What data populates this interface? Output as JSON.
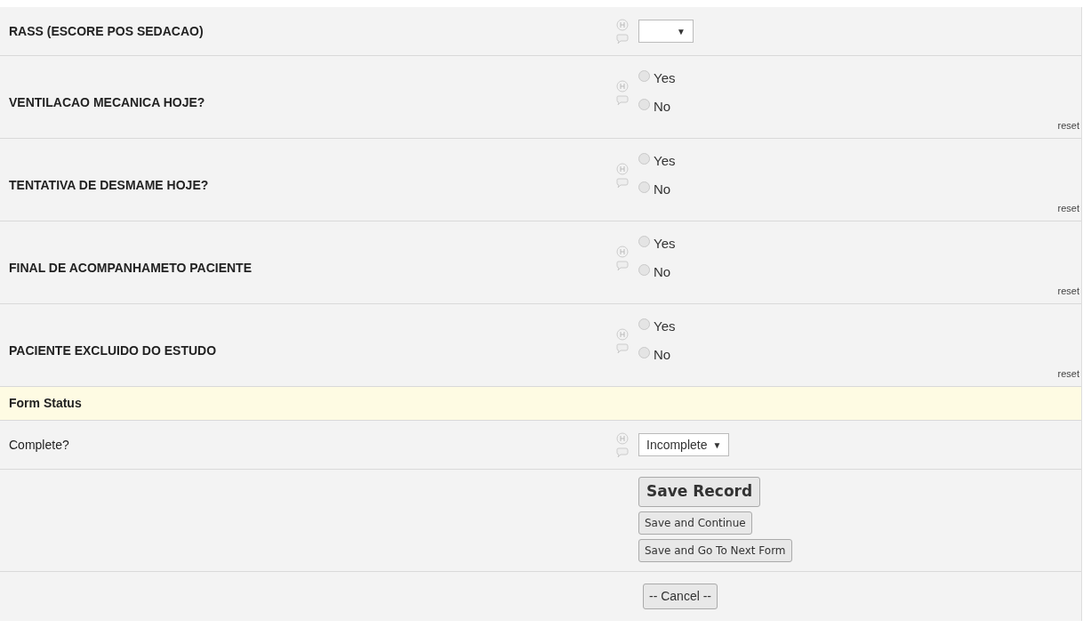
{
  "fields": [
    {
      "kind": "dropdown",
      "label": "RASS (ESCORE POS SEDACAO)",
      "caret": "▼"
    },
    {
      "kind": "radio",
      "label": "VENTILACAO MECANICA HOJE?",
      "options": [
        {
          "label": "Yes",
          "selected": false
        },
        {
          "label": "No",
          "selected": false
        }
      ],
      "reset": "reset"
    },
    {
      "kind": "radio",
      "label": "TENTATIVA DE DESMAME HOJE?",
      "options": [
        {
          "label": "Yes",
          "selected": false
        },
        {
          "label": "No",
          "selected": false
        }
      ],
      "reset": "reset"
    },
    {
      "kind": "radio",
      "label": "FINAL DE ACOMPANHAMETO PACIENTE",
      "options": [
        {
          "label": "Yes",
          "selected": false
        },
        {
          "label": "No",
          "selected": false
        }
      ],
      "reset": "reset"
    },
    {
      "kind": "radio",
      "label": "PACIENTE EXCLUIDO DO ESTUDO",
      "options": [
        {
          "label": "Yes",
          "selected": false
        },
        {
          "label": "No",
          "selected": false
        }
      ],
      "reset": "reset"
    }
  ],
  "section_header": "Form Status",
  "complete": {
    "label": "Complete?",
    "value": "Incomplete",
    "caret": "▼"
  },
  "buttons": {
    "primary": "Save Record",
    "secondary": [
      "Save and Continue",
      "Save and Go To Next Form"
    ]
  },
  "cancel": "-- Cancel --"
}
